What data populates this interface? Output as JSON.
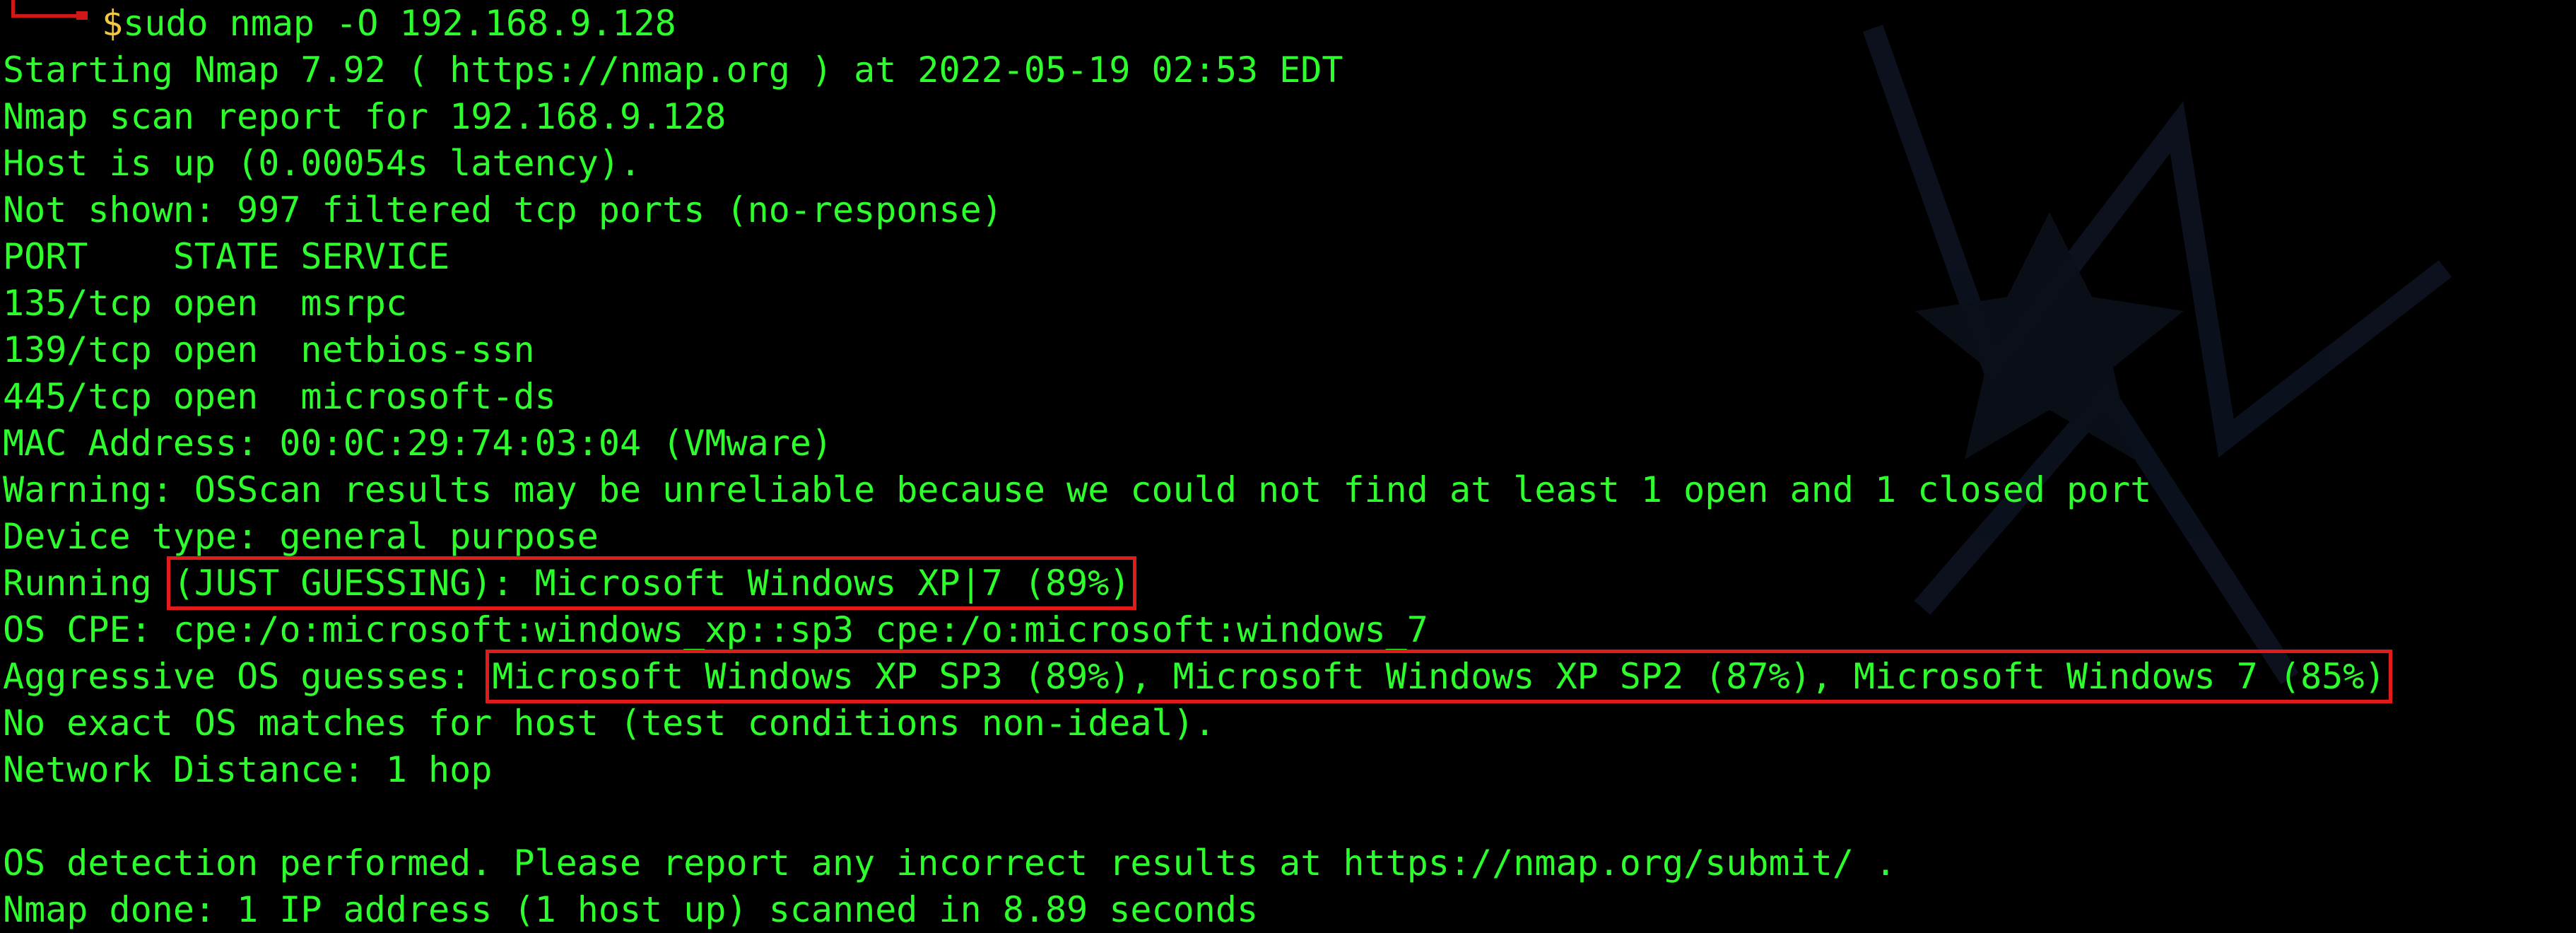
{
  "terminal": {
    "prompt_symbol": "$",
    "command": "sudo nmap -O 192.168.9.128",
    "output": {
      "starting": "Starting Nmap 7.92 ( https://nmap.org ) at 2022-05-19 02:53 EDT",
      "report": "Nmap scan report for 192.168.9.128",
      "host_up": "Host is up (0.00054s latency).",
      "not_shown": "Not shown: 997 filtered tcp ports (no-response)",
      "port_header": "PORT    STATE SERVICE",
      "ports": [
        "135/tcp open  msrpc",
        "139/tcp open  netbios-ssn",
        "445/tcp open  microsoft-ds"
      ],
      "mac": "MAC Address: 00:0C:29:74:03:04 (VMware)",
      "warning": "Warning: OSScan results may be unreliable because we could not find at least 1 open and 1 closed port",
      "device_type": "Device type: general purpose",
      "running_label": "Running ",
      "running_value": "(JUST GUESSING): Microsoft Windows XP|7 (89%)",
      "os_cpe": "OS CPE: cpe:/o:microsoft:windows_xp::sp3 cpe:/o:microsoft:windows_7",
      "aggressive_label": "Aggressive OS guesses: ",
      "aggressive_value": "Microsoft Windows XP SP3 (89%), Microsoft Windows XP SP2 (87%), Microsoft Windows 7 (85%)",
      "no_exact": "No exact OS matches for host (test conditions non-ideal).",
      "network_distance": "Network Distance: 1 hop",
      "os_detection": "OS detection performed. Please report any incorrect results at https://nmap.org/submit/ .",
      "done": "Nmap done: 1 IP address (1 host up) scanned in 8.89 seconds"
    }
  },
  "colors": {
    "background": "#000000",
    "text": "#2cff2c",
    "prompt_dollar": "#f2c744",
    "highlight_box": "#e21a1a"
  }
}
